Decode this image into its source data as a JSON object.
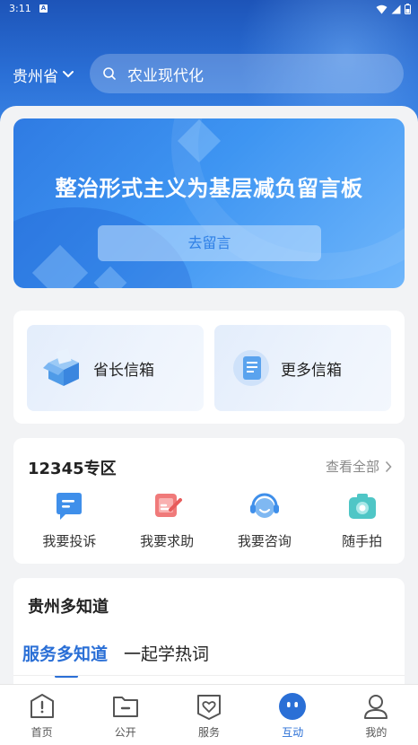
{
  "status_bar": {
    "time": "3:11",
    "notification_badge": "A"
  },
  "header": {
    "location": "贵州省",
    "search": {
      "value": "农业现代化"
    }
  },
  "banner": {
    "title": "整治形式主义为基层减负留言板",
    "button_label": "去留言"
  },
  "mailboxes": [
    {
      "label": "省长信箱",
      "icon": "open-box-icon"
    },
    {
      "label": "更多信箱",
      "icon": "document-icon"
    }
  ],
  "zone_12345": {
    "title": "12345专区",
    "view_all": "查看全部",
    "items": [
      {
        "label": "我要投诉",
        "icon": "complaint-icon"
      },
      {
        "label": "我要求助",
        "icon": "help-icon"
      },
      {
        "label": "我要咨询",
        "icon": "consult-icon"
      },
      {
        "label": "随手拍",
        "icon": "camera-icon"
      }
    ]
  },
  "knowledge": {
    "title": "贵州多知道",
    "tabs": [
      {
        "label": "服务多知道",
        "active": true
      },
      {
        "label": "一起学热词",
        "active": false
      }
    ]
  },
  "tab_bar": [
    {
      "label": "首页",
      "icon": "home-icon",
      "active": false
    },
    {
      "label": "公开",
      "icon": "folder-icon",
      "active": false
    },
    {
      "label": "服务",
      "icon": "service-icon",
      "active": false
    },
    {
      "label": "互动",
      "icon": "interact-icon",
      "active": true
    },
    {
      "label": "我的",
      "icon": "profile-icon",
      "active": false
    }
  ],
  "colors": {
    "primary": "#2a6fd6",
    "header_top": "#1d54b8",
    "banner": "#3e95f2"
  }
}
